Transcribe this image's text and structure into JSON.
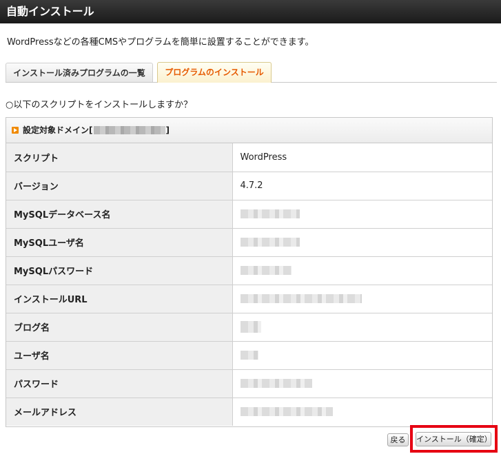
{
  "page": {
    "title": "自動インストール",
    "description": "WordPressなどの各種CMSやプログラムを簡単に設置することができます。"
  },
  "tabs": [
    {
      "label": "インストール済みプログラムの一覧",
      "active": false
    },
    {
      "label": "プログラムのインストール",
      "active": true
    }
  ],
  "question": "○以下のスクリプトをインストールしますか？",
  "panel": {
    "heading_prefix": "設定対象ドメイン[",
    "heading_suffix": "]",
    "rows": [
      {
        "label": "スクリプト",
        "value": "WordPress"
      },
      {
        "label": "バージョン",
        "value": "4.7.2"
      },
      {
        "label": "MySQLデータベース名",
        "value": ""
      },
      {
        "label": "MySQLユーザ名",
        "value": ""
      },
      {
        "label": "MySQLパスワード",
        "value": ""
      },
      {
        "label": "インストールURL",
        "value": ""
      },
      {
        "label": "ブログ名",
        "value": ""
      },
      {
        "label": "ユーザ名",
        "value": ""
      },
      {
        "label": "パスワード",
        "value": ""
      },
      {
        "label": "メールアドレス",
        "value": ""
      }
    ]
  },
  "buttons": {
    "back": "戻る",
    "install_confirm": "インストール（確定）"
  },
  "colors": {
    "active_tab_text": "#e65a00",
    "highlight_border": "#e60012",
    "heading_bullet": "#f08a00"
  }
}
